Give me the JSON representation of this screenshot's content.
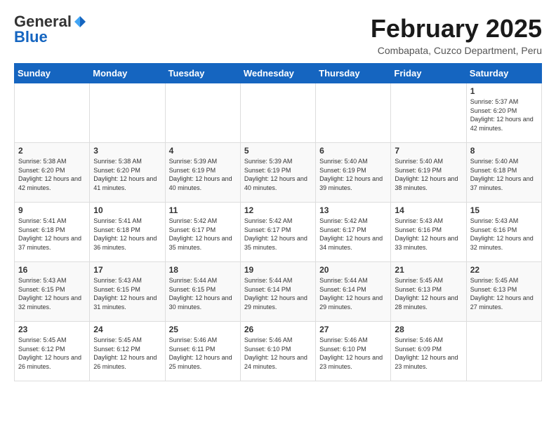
{
  "header": {
    "logo_general": "General",
    "logo_blue": "Blue",
    "month_title": "February 2025",
    "subtitle": "Combapata, Cuzco Department, Peru"
  },
  "weekdays": [
    "Sunday",
    "Monday",
    "Tuesday",
    "Wednesday",
    "Thursday",
    "Friday",
    "Saturday"
  ],
  "weeks": [
    [
      {
        "day": "",
        "info": ""
      },
      {
        "day": "",
        "info": ""
      },
      {
        "day": "",
        "info": ""
      },
      {
        "day": "",
        "info": ""
      },
      {
        "day": "",
        "info": ""
      },
      {
        "day": "",
        "info": ""
      },
      {
        "day": "1",
        "info": "Sunrise: 5:37 AM\nSunset: 6:20 PM\nDaylight: 12 hours and 42 minutes."
      }
    ],
    [
      {
        "day": "2",
        "info": "Sunrise: 5:38 AM\nSunset: 6:20 PM\nDaylight: 12 hours and 42 minutes."
      },
      {
        "day": "3",
        "info": "Sunrise: 5:38 AM\nSunset: 6:20 PM\nDaylight: 12 hours and 41 minutes."
      },
      {
        "day": "4",
        "info": "Sunrise: 5:39 AM\nSunset: 6:19 PM\nDaylight: 12 hours and 40 minutes."
      },
      {
        "day": "5",
        "info": "Sunrise: 5:39 AM\nSunset: 6:19 PM\nDaylight: 12 hours and 40 minutes."
      },
      {
        "day": "6",
        "info": "Sunrise: 5:40 AM\nSunset: 6:19 PM\nDaylight: 12 hours and 39 minutes."
      },
      {
        "day": "7",
        "info": "Sunrise: 5:40 AM\nSunset: 6:19 PM\nDaylight: 12 hours and 38 minutes."
      },
      {
        "day": "8",
        "info": "Sunrise: 5:40 AM\nSunset: 6:18 PM\nDaylight: 12 hours and 37 minutes."
      }
    ],
    [
      {
        "day": "9",
        "info": "Sunrise: 5:41 AM\nSunset: 6:18 PM\nDaylight: 12 hours and 37 minutes."
      },
      {
        "day": "10",
        "info": "Sunrise: 5:41 AM\nSunset: 6:18 PM\nDaylight: 12 hours and 36 minutes."
      },
      {
        "day": "11",
        "info": "Sunrise: 5:42 AM\nSunset: 6:17 PM\nDaylight: 12 hours and 35 minutes."
      },
      {
        "day": "12",
        "info": "Sunrise: 5:42 AM\nSunset: 6:17 PM\nDaylight: 12 hours and 35 minutes."
      },
      {
        "day": "13",
        "info": "Sunrise: 5:42 AM\nSunset: 6:17 PM\nDaylight: 12 hours and 34 minutes."
      },
      {
        "day": "14",
        "info": "Sunrise: 5:43 AM\nSunset: 6:16 PM\nDaylight: 12 hours and 33 minutes."
      },
      {
        "day": "15",
        "info": "Sunrise: 5:43 AM\nSunset: 6:16 PM\nDaylight: 12 hours and 32 minutes."
      }
    ],
    [
      {
        "day": "16",
        "info": "Sunrise: 5:43 AM\nSunset: 6:15 PM\nDaylight: 12 hours and 32 minutes."
      },
      {
        "day": "17",
        "info": "Sunrise: 5:43 AM\nSunset: 6:15 PM\nDaylight: 12 hours and 31 minutes."
      },
      {
        "day": "18",
        "info": "Sunrise: 5:44 AM\nSunset: 6:15 PM\nDaylight: 12 hours and 30 minutes."
      },
      {
        "day": "19",
        "info": "Sunrise: 5:44 AM\nSunset: 6:14 PM\nDaylight: 12 hours and 29 minutes."
      },
      {
        "day": "20",
        "info": "Sunrise: 5:44 AM\nSunset: 6:14 PM\nDaylight: 12 hours and 29 minutes."
      },
      {
        "day": "21",
        "info": "Sunrise: 5:45 AM\nSunset: 6:13 PM\nDaylight: 12 hours and 28 minutes."
      },
      {
        "day": "22",
        "info": "Sunrise: 5:45 AM\nSunset: 6:13 PM\nDaylight: 12 hours and 27 minutes."
      }
    ],
    [
      {
        "day": "23",
        "info": "Sunrise: 5:45 AM\nSunset: 6:12 PM\nDaylight: 12 hours and 26 minutes."
      },
      {
        "day": "24",
        "info": "Sunrise: 5:45 AM\nSunset: 6:12 PM\nDaylight: 12 hours and 26 minutes."
      },
      {
        "day": "25",
        "info": "Sunrise: 5:46 AM\nSunset: 6:11 PM\nDaylight: 12 hours and 25 minutes."
      },
      {
        "day": "26",
        "info": "Sunrise: 5:46 AM\nSunset: 6:10 PM\nDaylight: 12 hours and 24 minutes."
      },
      {
        "day": "27",
        "info": "Sunrise: 5:46 AM\nSunset: 6:10 PM\nDaylight: 12 hours and 23 minutes."
      },
      {
        "day": "28",
        "info": "Sunrise: 5:46 AM\nSunset: 6:09 PM\nDaylight: 12 hours and 23 minutes."
      },
      {
        "day": "",
        "info": ""
      }
    ]
  ]
}
